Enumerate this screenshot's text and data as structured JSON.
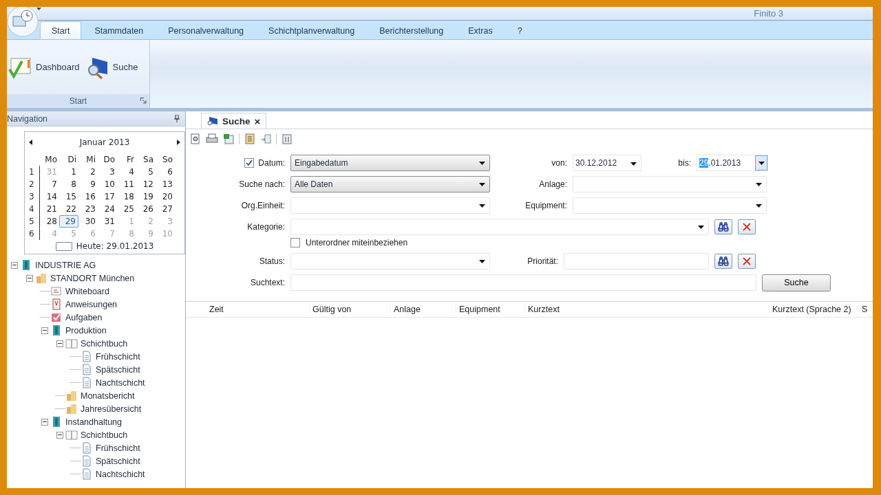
{
  "window": {
    "title": "Finito 3"
  },
  "ribbon": {
    "tabs": [
      {
        "label": "Start",
        "selected": true
      },
      {
        "label": "Stammdaten",
        "selected": false
      },
      {
        "label": "Personalverwaltung",
        "selected": false
      },
      {
        "label": "Schichtplanverwaltung",
        "selected": false
      },
      {
        "label": "Berichterstellung",
        "selected": false
      },
      {
        "label": "Extras",
        "selected": false
      },
      {
        "label": "?",
        "selected": false
      }
    ],
    "group": {
      "label": "Start",
      "buttons": [
        {
          "label": "Dashboard",
          "kind": "dashboard"
        },
        {
          "label": "Suche",
          "kind": "search"
        }
      ]
    }
  },
  "navigation": {
    "title": "Navigation",
    "calendar": {
      "month": "Januar 2013",
      "weekdays": [
        "Mo",
        "Di",
        "Mi",
        "Do",
        "Fr",
        "Sa",
        "So"
      ],
      "weeks": [
        {
          "number": "1",
          "days": [
            {
              "day": "31",
              "other_month": true,
              "selected": false
            },
            {
              "day": "1",
              "other_month": false,
              "selected": false
            },
            {
              "day": "2",
              "other_month": false,
              "selected": false
            },
            {
              "day": "3",
              "other_month": false,
              "selected": false
            },
            {
              "day": "4",
              "other_month": false,
              "selected": false
            },
            {
              "day": "5",
              "other_month": false,
              "selected": false
            },
            {
              "day": "6",
              "other_month": false,
              "selected": false
            }
          ]
        },
        {
          "number": "2",
          "days": [
            {
              "day": "7",
              "other_month": false,
              "selected": false
            },
            {
              "day": "8",
              "other_month": false,
              "selected": false
            },
            {
              "day": "9",
              "other_month": false,
              "selected": false
            },
            {
              "day": "10",
              "other_month": false,
              "selected": false
            },
            {
              "day": "11",
              "other_month": false,
              "selected": false
            },
            {
              "day": "12",
              "other_month": false,
              "selected": false
            },
            {
              "day": "13",
              "other_month": false,
              "selected": false
            }
          ]
        },
        {
          "number": "3",
          "days": [
            {
              "day": "14",
              "other_month": false,
              "selected": false
            },
            {
              "day": "15",
              "other_month": false,
              "selected": false
            },
            {
              "day": "16",
              "other_month": false,
              "selected": false
            },
            {
              "day": "17",
              "other_month": false,
              "selected": false
            },
            {
              "day": "18",
              "other_month": false,
              "selected": false
            },
            {
              "day": "19",
              "other_month": false,
              "selected": false
            },
            {
              "day": "20",
              "other_month": false,
              "selected": false
            }
          ]
        },
        {
          "number": "4",
          "days": [
            {
              "day": "21",
              "other_month": false,
              "selected": false
            },
            {
              "day": "22",
              "other_month": false,
              "selected": false
            },
            {
              "day": "23",
              "other_month": false,
              "selected": false
            },
            {
              "day": "24",
              "other_month": false,
              "selected": false
            },
            {
              "day": "25",
              "other_month": false,
              "selected": false
            },
            {
              "day": "26",
              "other_month": false,
              "selected": false
            },
            {
              "day": "27",
              "other_month": false,
              "selected": false
            }
          ]
        },
        {
          "number": "5",
          "days": [
            {
              "day": "28",
              "other_month": false,
              "selected": false
            },
            {
              "day": "29",
              "other_month": false,
              "selected": true
            },
            {
              "day": "30",
              "other_month": false,
              "selected": false
            },
            {
              "day": "31",
              "other_month": false,
              "selected": false
            },
            {
              "day": "1",
              "other_month": true,
              "selected": false
            },
            {
              "day": "2",
              "other_month": true,
              "selected": false
            },
            {
              "day": "3",
              "other_month": true,
              "selected": false
            }
          ]
        },
        {
          "number": "6",
          "days": [
            {
              "day": "4",
              "other_month": true,
              "selected": false
            },
            {
              "day": "5",
              "other_month": true,
              "selected": false
            },
            {
              "day": "6",
              "other_month": true,
              "selected": false
            },
            {
              "day": "7",
              "other_month": true,
              "selected": false
            },
            {
              "day": "8",
              "other_month": true,
              "selected": false
            },
            {
              "day": "9",
              "other_month": true,
              "selected": false
            },
            {
              "day": "10",
              "other_month": true,
              "selected": false
            }
          ]
        }
      ],
      "today": "Heute: 29.01.2013"
    },
    "tree": [
      {
        "label": "INDUSTRIE AG",
        "kind": "company",
        "expanded": true,
        "children": [
          {
            "label": "STANDORT München",
            "kind": "site",
            "expanded": true,
            "children": [
              {
                "label": "Whiteboard",
                "kind": "whiteboard"
              },
              {
                "label": "Anweisungen",
                "kind": "instructions"
              },
              {
                "label": "Aufgaben",
                "kind": "tasks"
              },
              {
                "label": "Produktion",
                "kind": "department",
                "expanded": true,
                "children": [
                  {
                    "label": "Schichtbuch",
                    "kind": "book",
                    "expanded": true,
                    "children": [
                      {
                        "label": "Frühschicht",
                        "kind": "page"
                      },
                      {
                        "label": "Spätschicht",
                        "kind": "page"
                      },
                      {
                        "label": "Nachtschicht",
                        "kind": "page"
                      }
                    ]
                  },
                  {
                    "label": "Monatsbericht",
                    "kind": "site"
                  },
                  {
                    "label": "Jahresübersicht",
                    "kind": "site"
                  }
                ]
              },
              {
                "label": "Instandhaltung",
                "kind": "department",
                "expanded": true,
                "children": [
                  {
                    "label": "Schichtbuch",
                    "kind": "book",
                    "expanded": true,
                    "children": [
                      {
                        "label": "Frühschicht",
                        "kind": "page"
                      },
                      {
                        "label": "Spätschicht",
                        "kind": "page"
                      },
                      {
                        "label": "Nachtschicht",
                        "kind": "page"
                      }
                    ]
                  }
                ]
              }
            ]
          }
        ]
      }
    ]
  },
  "document_tabs": [
    {
      "label": "Suche",
      "selected": true,
      "close": "×"
    }
  ],
  "search_form": {
    "datum": {
      "label": "Datum:",
      "checked": true,
      "value": "Eingabedatum"
    },
    "von": {
      "label": "von:",
      "value": "30.12.2012"
    },
    "bis": {
      "label": "bis:",
      "value_selected": "29",
      "value_rest": ".01.2013"
    },
    "suche_nach": {
      "label": "Suche nach:",
      "value": "Alle Daten"
    },
    "anlage": {
      "label": "Anlage:"
    },
    "org_einheit": {
      "label": "Org.Einheit:"
    },
    "equipment": {
      "label": "Equipment:"
    },
    "kategorie": {
      "label": "Kategorie:"
    },
    "unterordner": {
      "label": "Unterordner miteinbeziehen",
      "checked": false
    },
    "status": {
      "label": "Status:"
    },
    "prioritaet": {
      "label": "Priorität:"
    },
    "suchtext": {
      "label": "Suchtext:"
    },
    "submit": "Suche"
  },
  "results": {
    "columns": [
      "Zeit",
      "Gültig von",
      "Anlage",
      "Equipment",
      "Kurztext",
      "Kurztext (Sprache 2)",
      "S"
    ]
  }
}
